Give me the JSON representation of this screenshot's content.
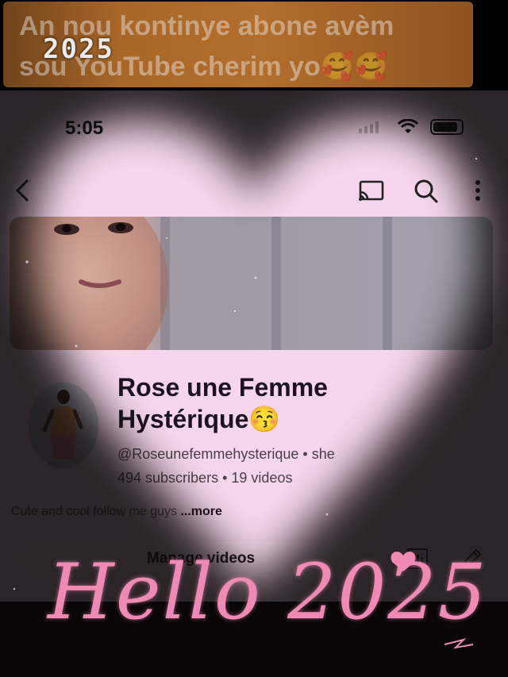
{
  "overlay": {
    "banner_line1": "An nou kontinye abone avèm",
    "banner_line2": "sou YouTube cherim yo🥰🥰",
    "year_badge": "2025",
    "hello_text": "Hello 2025"
  },
  "status_bar": {
    "time": "5:05"
  },
  "nav": {
    "back_icon": "chevron-left-icon",
    "cast_icon": "cast-icon",
    "search_icon": "search-icon",
    "more_icon": "more-vertical-icon"
  },
  "channel": {
    "name_line1": "Rose une Femme",
    "name_line2": "Hystérique😚",
    "handle": "@Roseunefemmehysterique",
    "pronoun": "she",
    "subscribers": "494 subscribers",
    "videos": "19 videos",
    "description": "Cute and cool follow me guys",
    "more": "...more",
    "manage_videos": "Manage videos"
  },
  "colors": {
    "screen_bg": "#f6d6ec",
    "hello_pink": "#ef8ab5",
    "banner_orange": "#c27830"
  }
}
